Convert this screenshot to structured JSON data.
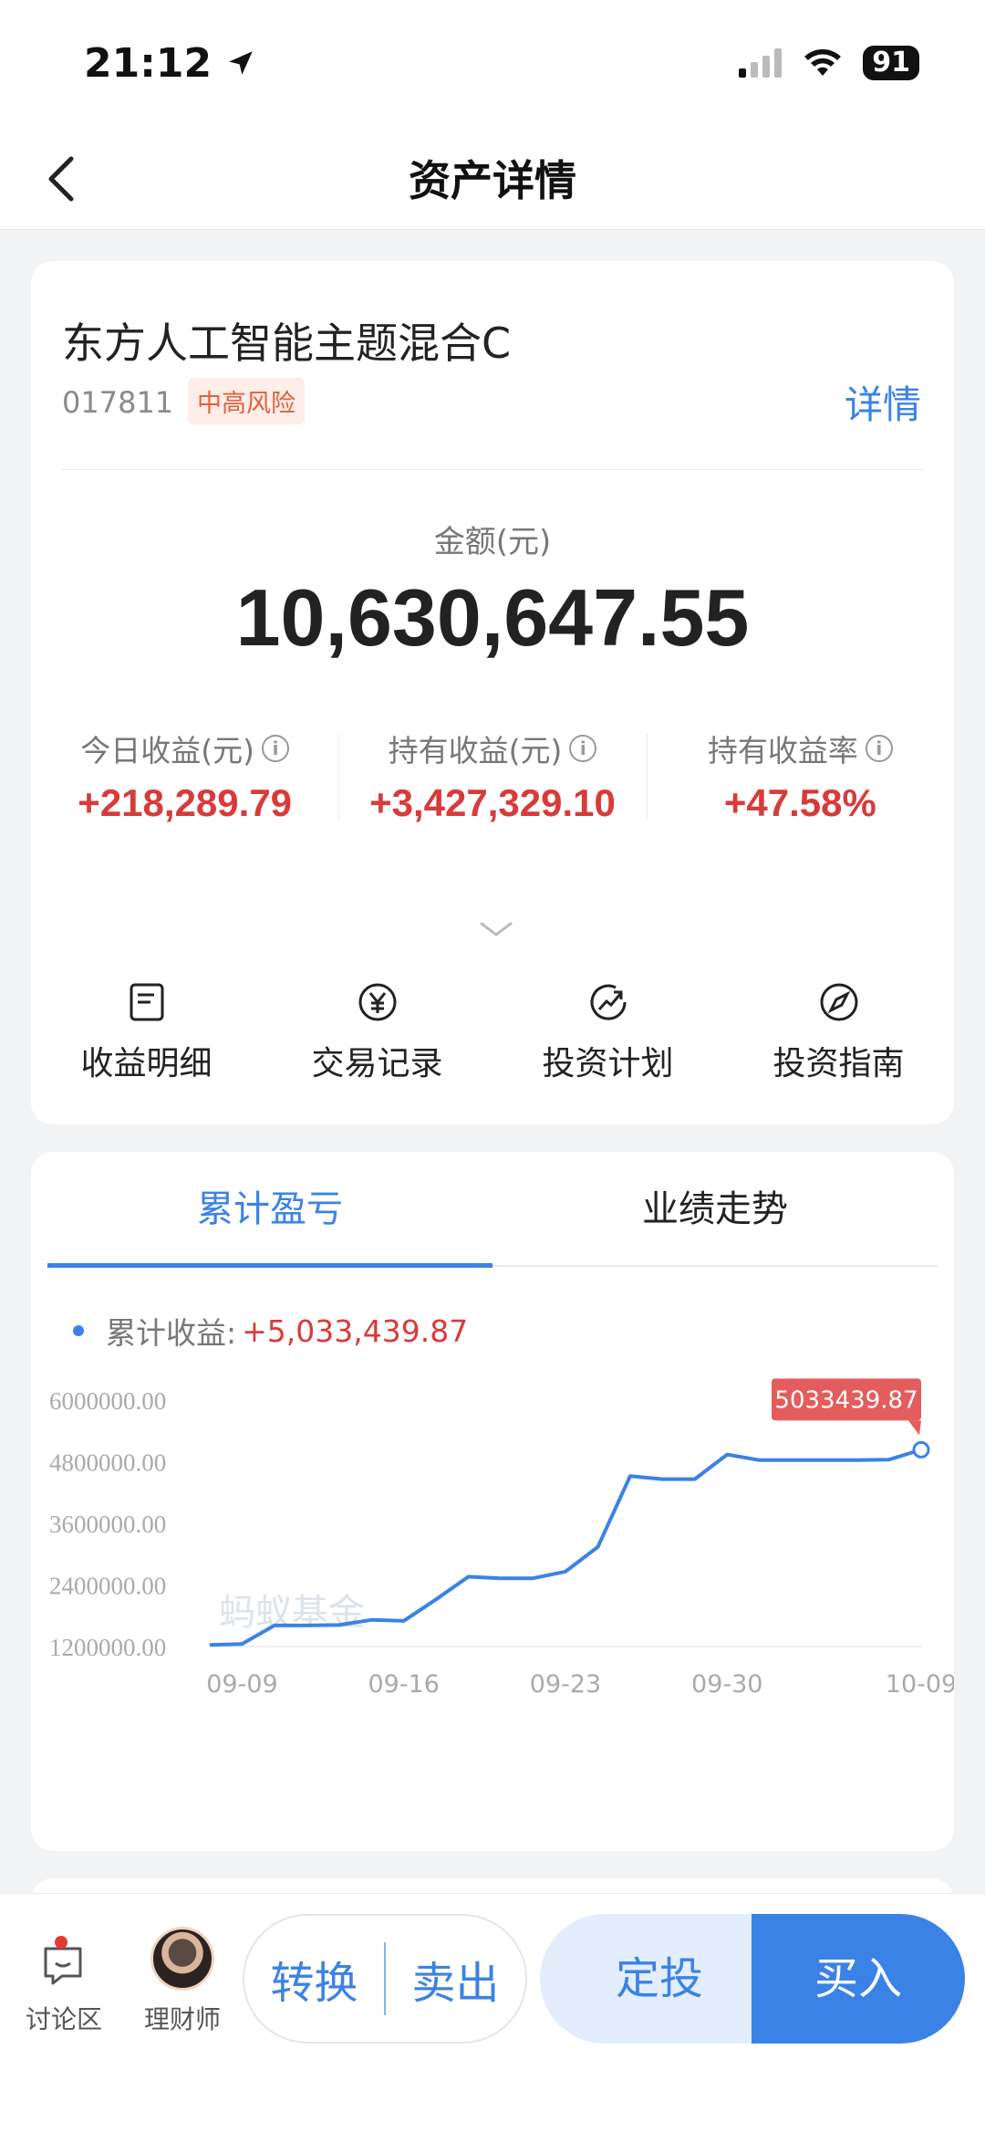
{
  "status_bar": {
    "time": "21:12",
    "battery": "91"
  },
  "nav": {
    "title": "资产详情"
  },
  "fund": {
    "name": "东方人工智能主题混合C",
    "code": "017811",
    "risk": "中高风险",
    "detail_link": "详情"
  },
  "amount": {
    "label": "金额(元)",
    "value": "10,630,647.55"
  },
  "stats": [
    {
      "label": "今日收益(元)",
      "value": "+218,289.79"
    },
    {
      "label": "持有收益(元)",
      "value": "+3,427,329.10"
    },
    {
      "label": "持有收益率",
      "value": "+47.58%"
    }
  ],
  "actions": [
    {
      "label": "收益明细",
      "icon": "document-icon"
    },
    {
      "label": "交易记录",
      "icon": "yuan-circle-icon"
    },
    {
      "label": "投资计划",
      "icon": "trend-circle-icon"
    },
    {
      "label": "投资指南",
      "icon": "compass-icon"
    }
  ],
  "chart_tabs": [
    "累计盈亏",
    "业绩走势"
  ],
  "legend": {
    "label": "累计收益:",
    "value": "+5,033,439.87"
  },
  "watermark": "蚂蚁基金",
  "colors": {
    "accent": "#3b82e6",
    "gain": "#d93a3a",
    "risk": "#e0603c"
  },
  "chart_data": {
    "type": "line",
    "title": "",
    "xlabel": "",
    "ylabel": "",
    "ylim": [
      1200000,
      6000000
    ],
    "yticks": [
      "6000000.00",
      "4800000.00",
      "3600000.00",
      "2400000.00",
      "1200000.00"
    ],
    "xticks": [
      "09-09",
      "09-16",
      "09-23",
      "09-30",
      "10-09"
    ],
    "series": [
      {
        "x": [
          "09-06",
          "09-09",
          "09-10",
          "09-11",
          "09-12",
          "09-13",
          "09-16",
          "09-17",
          "09-18",
          "09-19",
          "09-20",
          "09-23",
          "09-24",
          "09-25",
          "09-26",
          "09-27",
          "09-30",
          "10-01",
          "10-02",
          "10-03",
          "10-04",
          "10-08",
          "10-09"
        ],
        "values": [
          1230000,
          1250000,
          1610000,
          1610000,
          1620000,
          1720000,
          1700000,
          2120000,
          2560000,
          2530000,
          2530000,
          2660000,
          3140000,
          4520000,
          4460000,
          4460000,
          4940000,
          4830000,
          4830000,
          4830000,
          4830000,
          4840000,
          5033439.87
        ]
      }
    ],
    "last_point_label": "5033439.87"
  }
}
